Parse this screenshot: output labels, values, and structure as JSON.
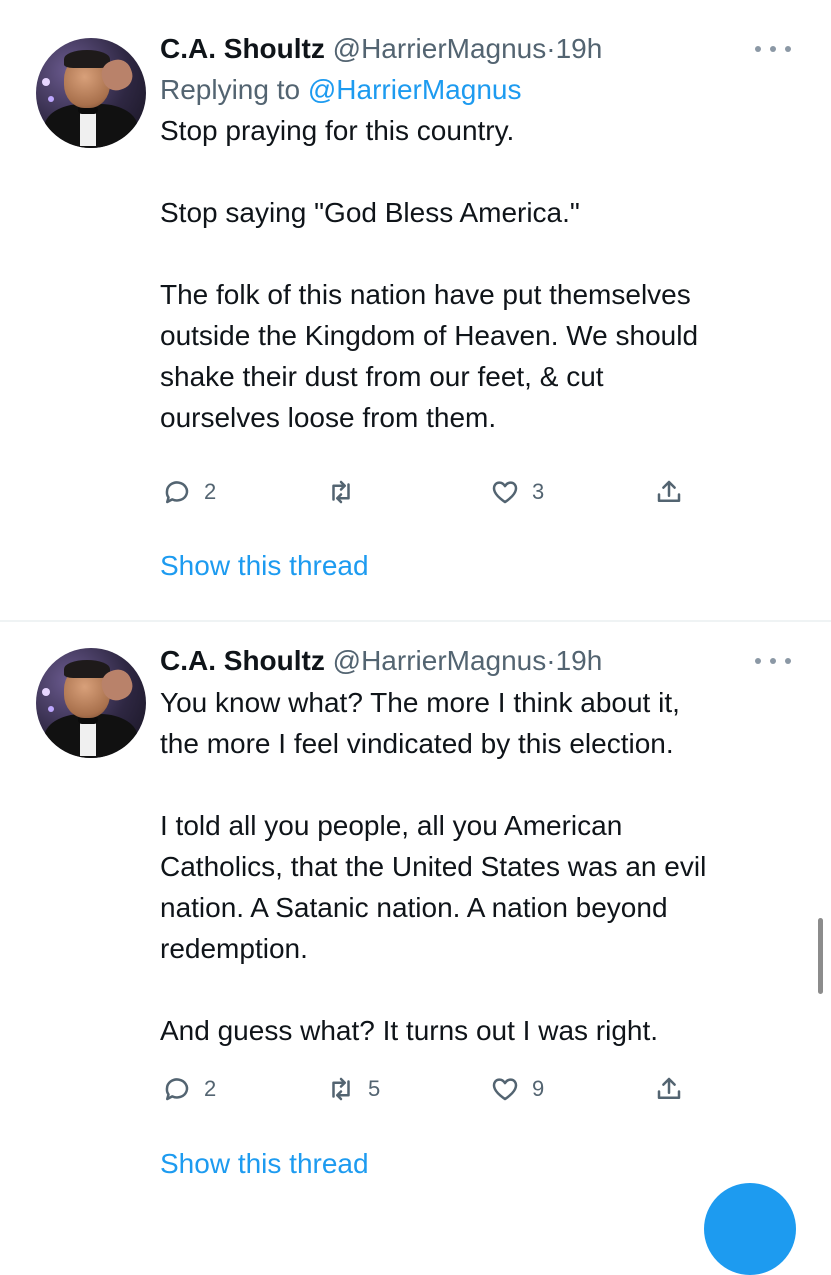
{
  "tweets": [
    {
      "author_name": "C.A. Shoultz",
      "handle": "@HarrierMagnus",
      "separator": "·",
      "time": "19h",
      "replying_prefix": "Replying to",
      "replying_to": "@HarrierMagnus",
      "paragraphs": [
        [
          "Stop praying for this country."
        ],
        [
          "Stop saying \"God Bless America.\""
        ],
        [
          "The folk of this nation have put themselves",
          "outside the Kingdom of Heaven.  We should",
          "shake their dust from our feet, & cut",
          "ourselves loose from them."
        ]
      ],
      "replies": "2",
      "retweets": "",
      "likes": "3",
      "show_thread": "Show this thread"
    },
    {
      "author_name": "C.A. Shoultz",
      "handle": "@HarrierMagnus",
      "separator": "·",
      "time": "19h",
      "paragraphs": [
        [
          "You know what?  The more I think about it,",
          "the more I feel vindicated by this election."
        ],
        [
          "I told all you people, all you American",
          "Catholics, that the United States was an evil",
          "nation.  A Satanic nation.  A nation beyond",
          "redemption."
        ],
        [
          "And guess what?  It turns out I was right."
        ]
      ],
      "replies": "2",
      "retweets": "5",
      "likes": "9",
      "show_thread": "Show this thread"
    }
  ],
  "icons": {
    "reply": "reply-icon",
    "retweet": "retweet-icon",
    "like": "heart-icon",
    "share": "share-icon",
    "more": "more-icon"
  },
  "colors": {
    "link": "#1d9bf0",
    "secondary_text": "#536471",
    "primary_text": "#0f1419"
  }
}
